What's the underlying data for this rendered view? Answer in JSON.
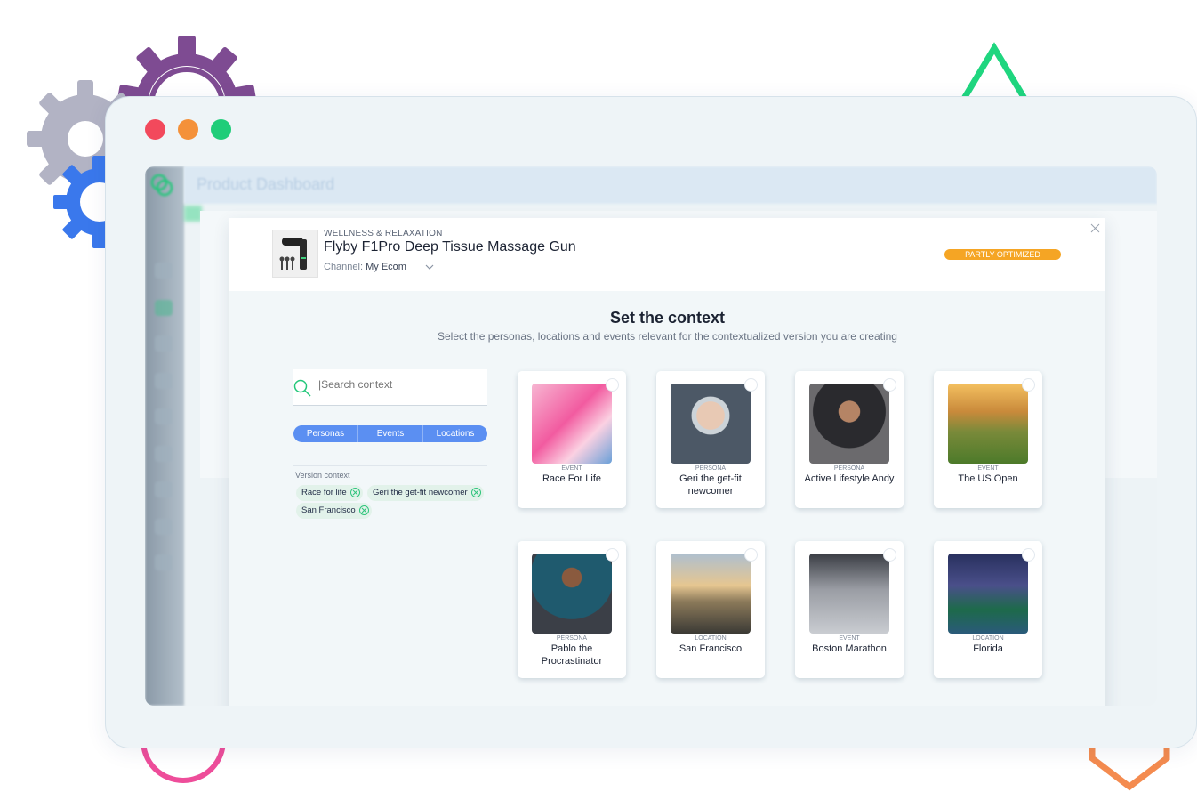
{
  "app": {
    "title": "Product Dashboard"
  },
  "product": {
    "category": "WELLNESS & RELAXATION",
    "name": "Flyby F1Pro Deep Tissue Massage Gun",
    "channel_label": "Channel:",
    "channel_value": "My Ecom",
    "status": "PARTLY OPTIMIZED"
  },
  "context": {
    "title": "Set the context",
    "subtitle": "Select the personas, locations and events relevant for the contextualized version you are creating",
    "search_placeholder": "|Search context",
    "tabs": [
      "Personas",
      "Events",
      "Locations"
    ],
    "version_context_label": "Version context",
    "chips": [
      "Race for life",
      "Geri the get-fit newcomer",
      "San Francisco"
    ]
  },
  "cards": [
    {
      "type": "EVENT",
      "name": "Race For Life"
    },
    {
      "type": "PERSONA",
      "name": "Geri the get-fit newcomer"
    },
    {
      "type": "PERSONA",
      "name": "Active Lifestyle Andy"
    },
    {
      "type": "EVENT",
      "name": "The US Open"
    },
    {
      "type": "PERSONA",
      "name": "Pablo the Procrastinator"
    },
    {
      "type": "LOCATION",
      "name": "San Francisco"
    },
    {
      "type": "EVENT",
      "name": "Boston Marathon"
    },
    {
      "type": "LOCATION",
      "name": "Florida"
    }
  ],
  "colors": {
    "accent_blue": "#5b8ff2",
    "status_orange": "#f5a524",
    "green": "#2fc47c",
    "traffic_red": "#f2495c",
    "traffic_orange": "#f4913a",
    "traffic_green": "#1fcd79"
  },
  "icons": [
    "gear-icon",
    "search-icon",
    "close-icon",
    "chevron-down-icon",
    "remove-chip-icon",
    "triangle-shape",
    "hexagon-shape",
    "circle-shape"
  ]
}
